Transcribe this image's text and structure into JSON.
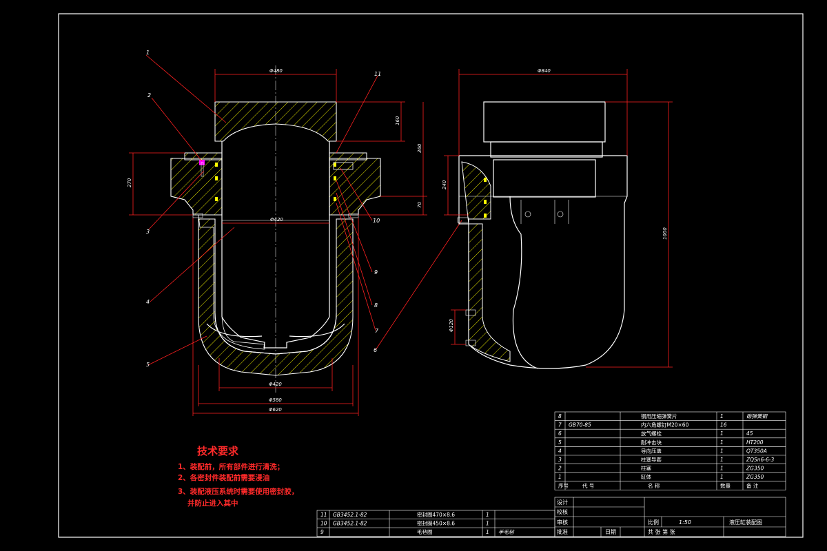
{
  "colors": {
    "background": "#000000",
    "outline": "#ffffff",
    "dimension": "#ff2020",
    "hatch": "#ffff00",
    "requirements_text": "#ff2a2a",
    "seal": "#ffff00",
    "bolt_head": "#ff00ff"
  },
  "leaders": {
    "l1": "1",
    "l2": "2",
    "l3": "3",
    "l4": "4",
    "l5": "5",
    "l6": "6",
    "l7": "7",
    "l8": "8",
    "l9": "9",
    "l10": "10",
    "l11": "11"
  },
  "dims": {
    "top_width": "Φ480",
    "inner_dia": "Φ420",
    "bottom_420": "Φ420",
    "d580": "Φ580",
    "d620": "Φ620",
    "h270": "270",
    "h160": "160",
    "h360": "360",
    "h70": "70",
    "side_top": "Φ840",
    "side_240": "240",
    "side_1000": "1000",
    "side_120": "Φ120"
  },
  "requirements": {
    "title": "技术要求",
    "line1": "1、装配前，所有部件进行清洗；",
    "line2": "2、各密封件装配前需要浸油",
    "line3": "3、装配液压系统时需要使用密封胶，",
    "line4": "并防止进入其中"
  },
  "bom": {
    "rows": [
      {
        "no": "8",
        "code": "",
        "name": "钢用压缩弹簧片",
        "qty": "1",
        "material": "碳弹簧钢"
      },
      {
        "no": "7",
        "code": "GB70-85",
        "name": "内六角螺钉M20×60",
        "qty": "16",
        "material": ""
      },
      {
        "no": "6",
        "code": "",
        "name": "放气螺栓",
        "qty": "1",
        "material": "45"
      },
      {
        "no": "5",
        "code": "",
        "name": "耐冲击块",
        "qty": "1",
        "material": "HT200"
      },
      {
        "no": "4",
        "code": "",
        "name": "导向压盖",
        "qty": "1",
        "material": "QT350A"
      },
      {
        "no": "3",
        "code": "",
        "name": "柱塞导套",
        "qty": "1",
        "material": "ZQSn6-6-3"
      },
      {
        "no": "2",
        "code": "",
        "name": "柱塞",
        "qty": "1",
        "material": "ZG350"
      },
      {
        "no": "1",
        "code": "",
        "name": "缸体",
        "qty": "1",
        "material": "ZG350"
      }
    ],
    "header": {
      "no": "序号",
      "code": "代  号",
      "name": "名  称",
      "qty": "数量",
      "material": "备  注"
    }
  },
  "bom2": {
    "rows": [
      {
        "no": "11",
        "code": "GB3452.1-82",
        "name": "密封圈470×8.6",
        "qty": "1",
        "material": ""
      },
      {
        "no": "10",
        "code": "GB3452.1-82",
        "name": "密封圈450×8.6",
        "qty": "1",
        "material": ""
      },
      {
        "no": "9",
        "code": "",
        "name": "毛毡圈",
        "qty": "1",
        "material": "半毛毡"
      }
    ]
  },
  "titleblock": {
    "design": "设计",
    "check": "校核",
    "review": "审核",
    "approve": "批准",
    "date": "日期",
    "scale_label": "比例",
    "scale_value": "1:50",
    "title": "液压缸装配图",
    "sheet": "共  张  第  张"
  }
}
